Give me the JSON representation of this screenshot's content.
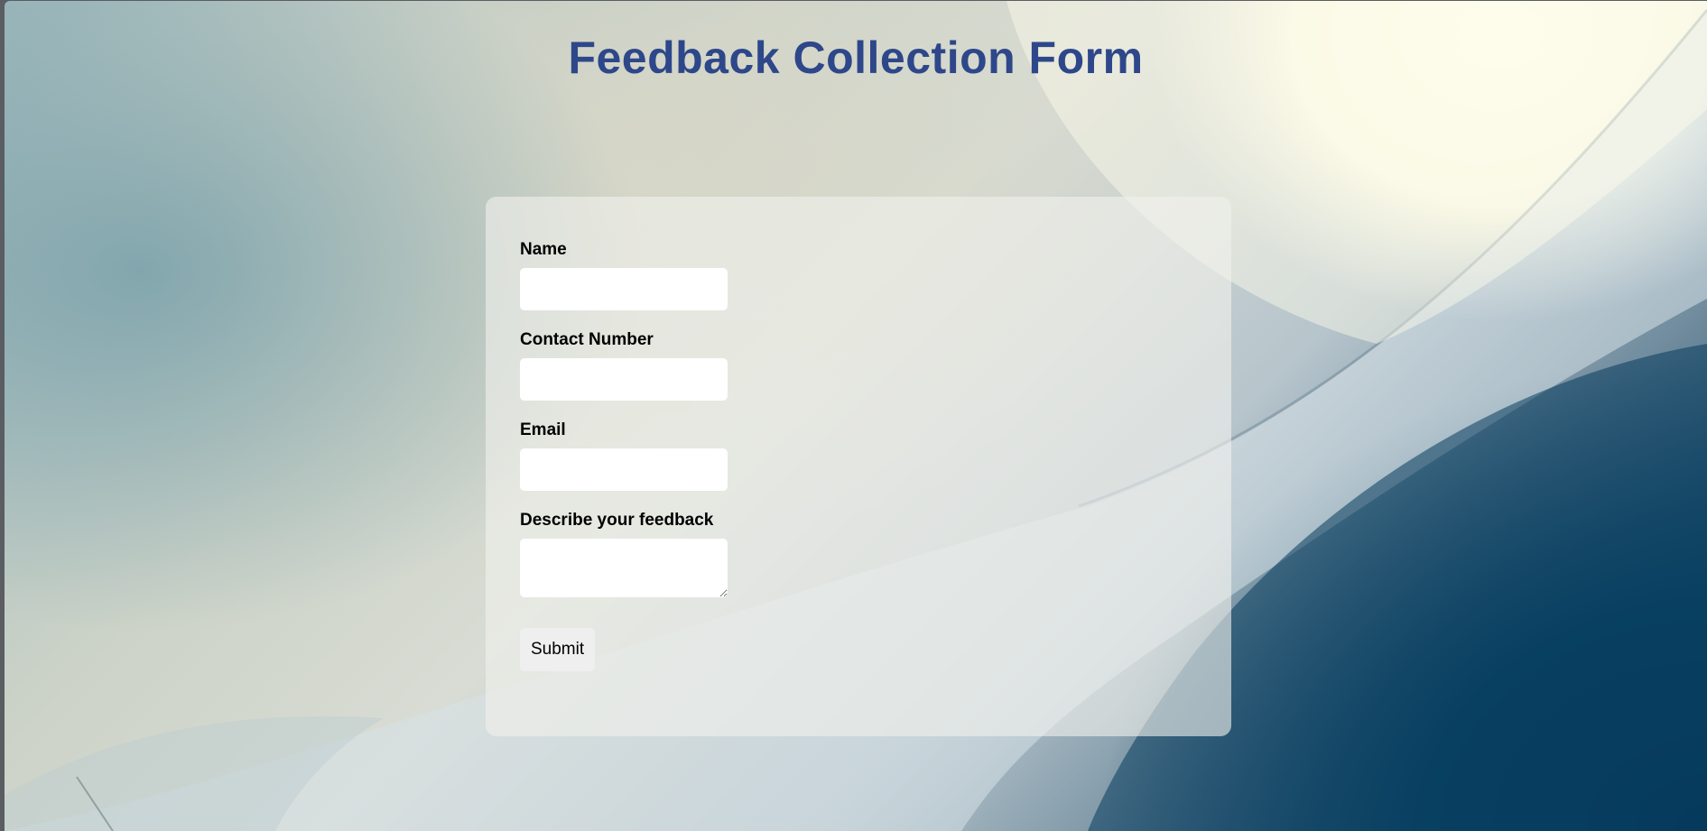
{
  "page": {
    "title": "Feedback Collection Form"
  },
  "form": {
    "fields": [
      {
        "label": "Name",
        "value": "",
        "type": "text"
      },
      {
        "label": "Contact Number",
        "value": "",
        "type": "text"
      },
      {
        "label": "Email",
        "value": "",
        "type": "email"
      },
      {
        "label": "Describe your feedback",
        "value": "",
        "type": "textarea"
      }
    ],
    "submit_label": "Submit"
  },
  "colors": {
    "title": "#2e478a",
    "card": "rgba(240,240,235,0.62)",
    "input_bg": "#ffffff",
    "button_bg": "#efefef"
  }
}
